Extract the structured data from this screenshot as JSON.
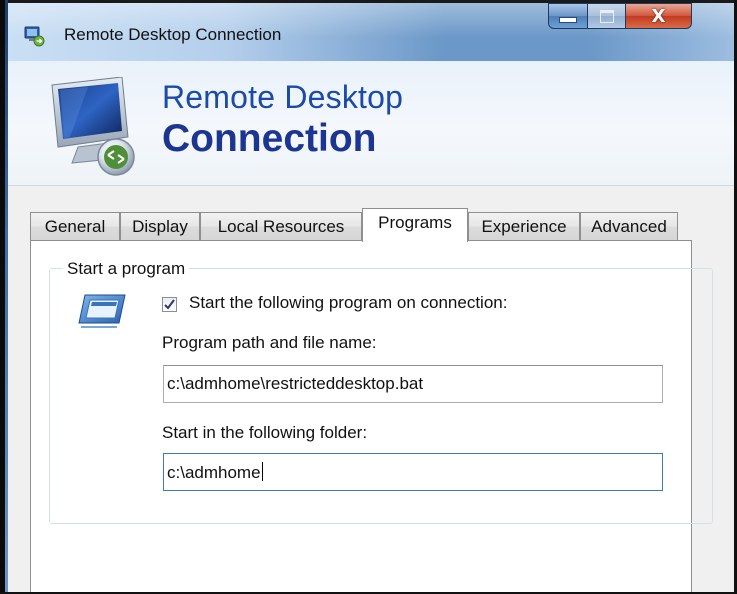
{
  "window": {
    "title": "Remote Desktop Connection",
    "controls": {
      "minimize": "minimize",
      "maximize": "maximize",
      "close": "X"
    }
  },
  "banner": {
    "line1": "Remote Desktop",
    "line2": "Connection"
  },
  "tabs": [
    {
      "label": "General",
      "active": false
    },
    {
      "label": "Display",
      "active": false
    },
    {
      "label": "Local Resources",
      "active": false
    },
    {
      "label": "Programs",
      "active": true
    },
    {
      "label": "Experience",
      "active": false
    },
    {
      "label": "Advanced",
      "active": false
    }
  ],
  "programs": {
    "group_title": "Start a program",
    "start_program_checkbox": {
      "label": "Start the following program on connection:",
      "checked": true
    },
    "program_path": {
      "label": "Program path and file name:",
      "value": "c:\\admhome\\restricteddesktop.bat"
    },
    "start_folder": {
      "label": "Start in the following folder:",
      "value": "c:\\admhome"
    }
  },
  "icons": {
    "title": "remote-desktop-icon",
    "banner": "monitor-connection-icon",
    "program": "program-window-icon",
    "check": "checkmark-icon"
  },
  "colors": {
    "banner_title": "#1b4aa8",
    "focus_border": "#3d7bad",
    "close_button": "#c23b20"
  }
}
